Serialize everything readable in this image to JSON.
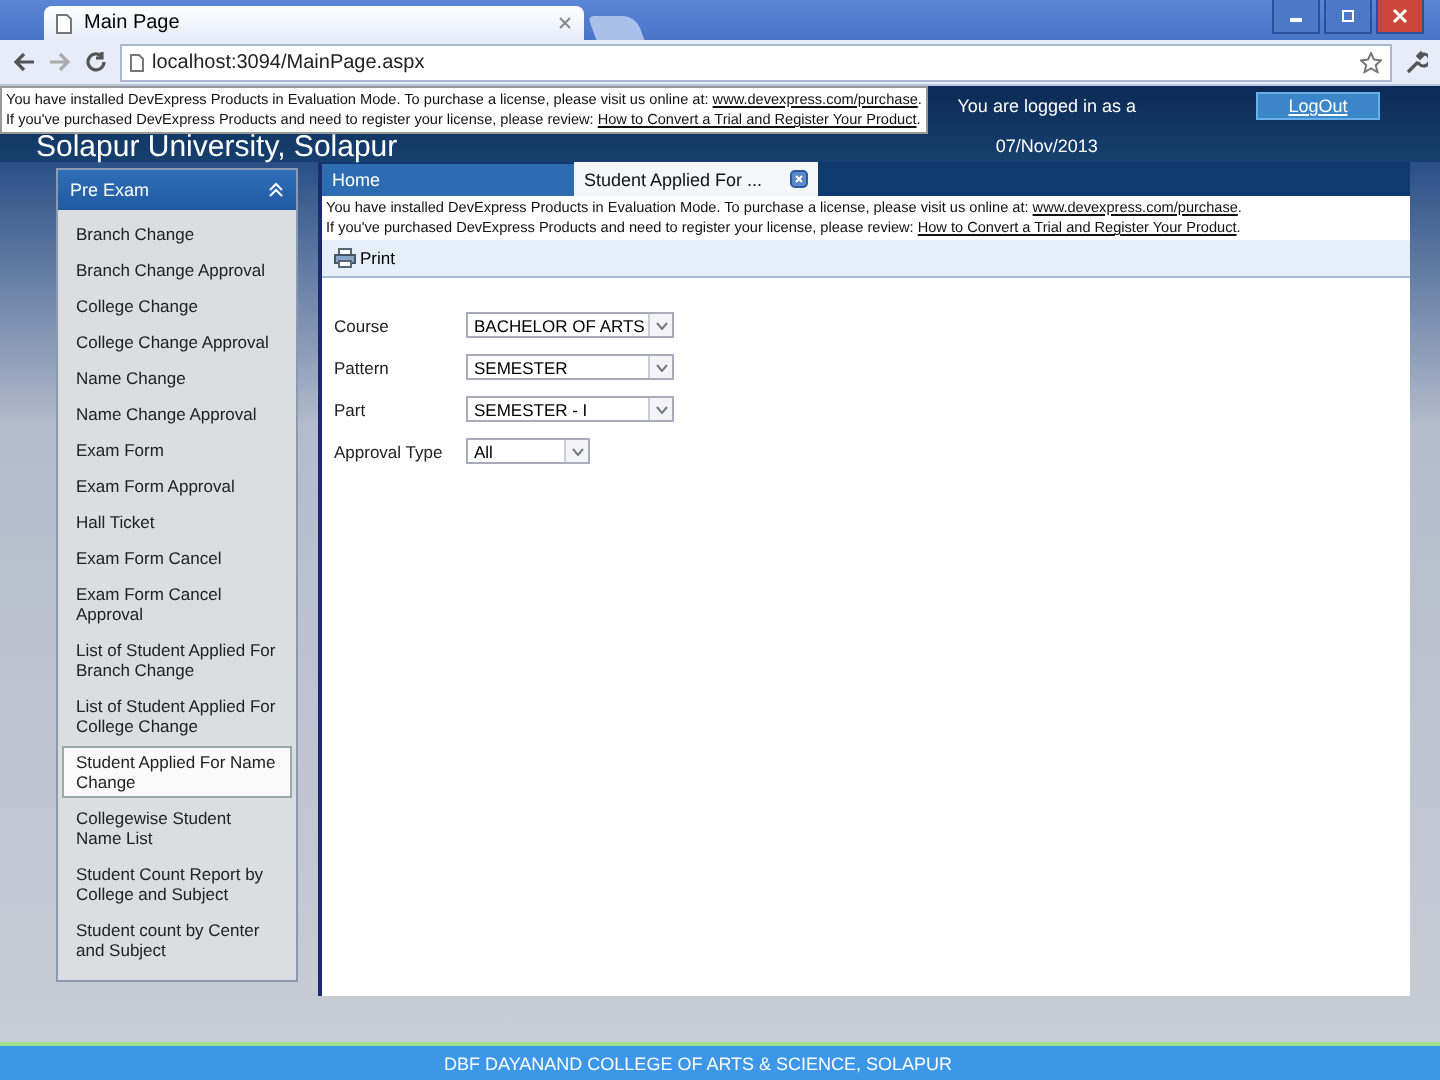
{
  "browser": {
    "tab_title": "Main Page",
    "url": "localhost:3094/MainPage.aspx"
  },
  "header": {
    "title": "Solapur University, Solapur",
    "login_text": "You are logged in as a",
    "logout": "LogOut",
    "date": "07/Nov/2013"
  },
  "header_notice": [
    {
      "text": "You have installed DevExpress Products in Evaluation Mode. To purchase a license, please visit us online at:",
      "link": "www.devexpress.com/purchase",
      "after": "."
    },
    {
      "text": "If you've purchased DevExpress Products and need to register your license, please review:",
      "link": "How to Convert a Trial and Register Your Product",
      "after": "."
    }
  ],
  "sidebar": {
    "group": "Pre Exam",
    "expanded": true,
    "items": [
      {
        "label": "Branch Change",
        "selected": false
      },
      {
        "label": "Branch Change Approval",
        "selected": false
      },
      {
        "label": "College Change",
        "selected": false
      },
      {
        "label": "College Change Approval",
        "selected": false
      },
      {
        "label": "Name Change",
        "selected": false
      },
      {
        "label": "Name Change Approval",
        "selected": false
      },
      {
        "label": "Exam Form",
        "selected": false
      },
      {
        "label": "Exam Form Approval",
        "selected": false
      },
      {
        "label": "Hall Ticket",
        "selected": false
      },
      {
        "label": "Exam Form Cancel",
        "selected": false
      },
      {
        "label": "Exam Form Cancel Approval",
        "selected": false
      },
      {
        "label": "List of Student Applied For Branch Change",
        "selected": false
      },
      {
        "label": "List of Student Applied For College Change",
        "selected": false
      },
      {
        "label": "Student Applied For Name Change",
        "selected": true
      },
      {
        "label": "Collegewise Student Name List",
        "selected": false
      },
      {
        "label": "Student Count Report by College and Subject",
        "selected": false
      },
      {
        "label": "Student count by Center and Subject",
        "selected": false
      }
    ]
  },
  "tabs": [
    {
      "label": "Home",
      "selected": false,
      "closable": false
    },
    {
      "label": "Student Applied For ...",
      "selected": true,
      "closable": true
    }
  ],
  "content_notice": [
    {
      "text": "You have installed DevExpress Products in Evaluation Mode. To purchase a license, please visit us online at:",
      "link": "www.devexpress.com/purchase",
      "after": "."
    },
    {
      "text": "If you've purchased DevExpress Products and need to register your license, please review:",
      "link": "How to Convert a Trial and Register Your Product",
      "after": "."
    }
  ],
  "toolbar": {
    "print": "Print"
  },
  "form": [
    {
      "label": "Course",
      "value": "BACHELOR OF ARTS",
      "wide": true
    },
    {
      "label": "Pattern",
      "value": "SEMESTER",
      "wide": true
    },
    {
      "label": "Part",
      "value": "SEMESTER - I",
      "wide": true
    },
    {
      "label": "Approval Type",
      "value": "All",
      "wide": false
    }
  ],
  "footer": "DBF DAYANAND COLLEGE OF ARTS & SCIENCE, SOLAPUR"
}
